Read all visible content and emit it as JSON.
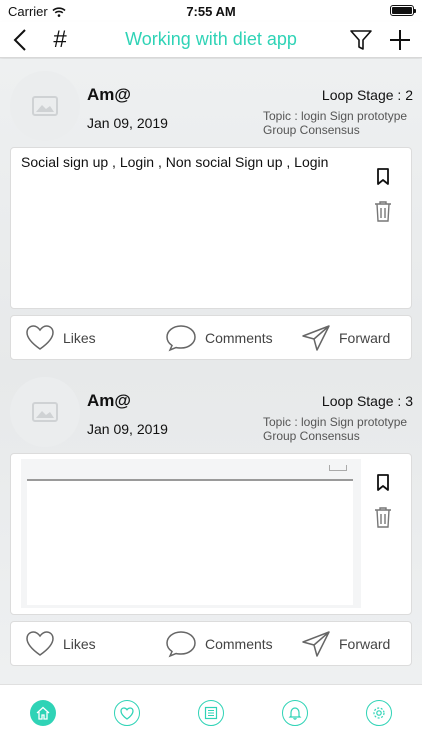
{
  "status_bar": {
    "carrier": "Carrier",
    "time": "7:55 AM"
  },
  "nav": {
    "title": "Working with diet app",
    "hash_label": "#"
  },
  "posts": [
    {
      "author": "Am@",
      "date": "Jan 09, 2019",
      "stage": "Loop Stage : 2",
      "topic": "Topic : login Sign prototype Group Consensus",
      "text": "Social sign up , Login , Non social Sign up , Login",
      "actions": {
        "likes": "Likes",
        "comments": "Comments",
        "forward": "Forward"
      }
    },
    {
      "author": "Am@",
      "date": "Jan 09, 2019",
      "stage": "Loop Stage : 3",
      "topic": "Topic : login Sign prototype Group Consensus",
      "text": "",
      "actions": {
        "likes": "Likes",
        "comments": "Comments",
        "forward": "Forward"
      }
    }
  ],
  "tab_bar": {
    "tabs": [
      {
        "icon": "home-icon",
        "active": true
      },
      {
        "icon": "heart-icon",
        "active": false
      },
      {
        "icon": "list-icon",
        "active": false
      },
      {
        "icon": "bell-icon",
        "active": false
      },
      {
        "icon": "gear-icon",
        "active": false
      }
    ]
  },
  "colors": {
    "accent": "#2fd3b6"
  }
}
